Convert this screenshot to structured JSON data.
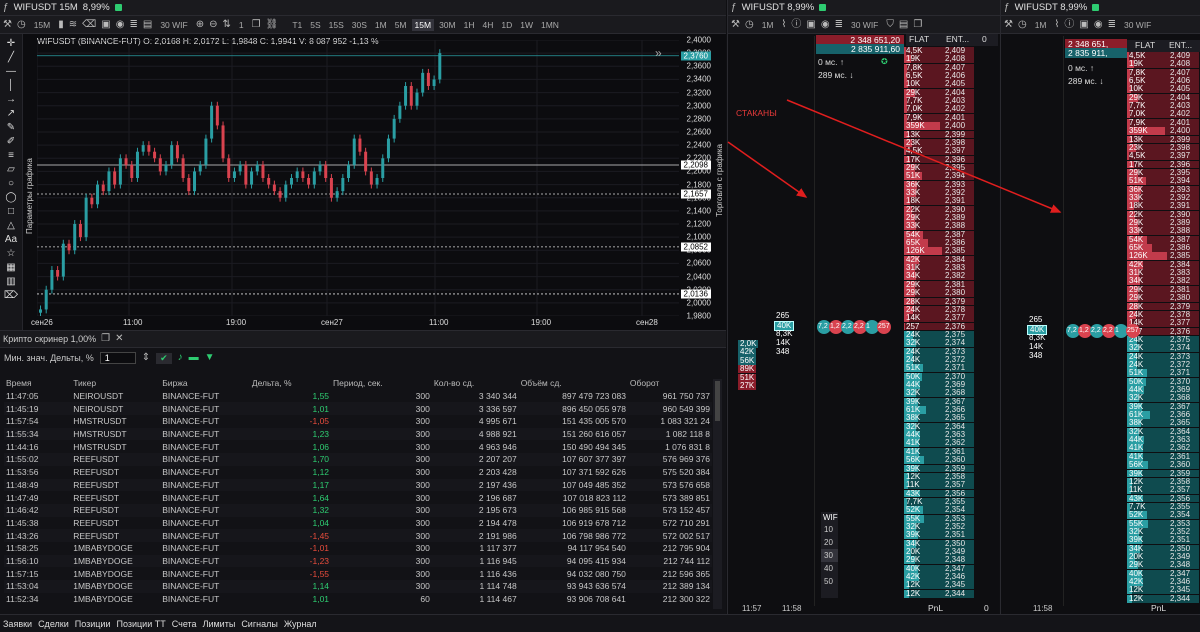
{
  "chart_window": {
    "title": "WIFUSDT 15M",
    "change": "8,99%",
    "interval": "15M",
    "lot": "30 WIF",
    "counter": "1",
    "timeframes": [
      "T1",
      "5S",
      "15S",
      "30S",
      "1M",
      "5M",
      "15M",
      "30M",
      "1H",
      "4H",
      "1D",
      "1W",
      "1MN"
    ],
    "active_tf": "15M",
    "ohlc": "WIFUSDT (BINANCE-FUT) O: 2,0168  H: 2,0172  L: 1,9848  C: 1,9941  V: 8 087 952  -1,13 %",
    "side_label_left": "Параметры графика",
    "side_label_right": "Торговля с графика",
    "price_labels": [
      "2,3760",
      "2,2098",
      "2,1657",
      "2,0852",
      "2,0136"
    ]
  },
  "chart_data": {
    "type": "candlestick",
    "ylim": [
      1.98,
      2.4
    ],
    "y_ticks": [
      "2,4000",
      "2,3800",
      "2,3600",
      "2,3400",
      "2,3200",
      "2,3000",
      "2,2800",
      "2,2600",
      "2,2400",
      "2,2200",
      "2,2000",
      "2,1800",
      "2,1600",
      "2,1400",
      "2,1200",
      "2,1000",
      "2,0800",
      "2,0600",
      "2,0400",
      "2,0200",
      "2,0000",
      "1,9800"
    ],
    "x_ticks": [
      "сен26",
      "11:00",
      "19:00",
      "сен27",
      "11:00",
      "19:00",
      "сен28"
    ],
    "horizontal_levels": [
      2.376,
      2.2098,
      2.1657,
      2.0852,
      2.0136
    ],
    "close_path": [
      1.99,
      2.02,
      2.05,
      2.04,
      2.09,
      2.08,
      2.12,
      2.1,
      2.16,
      2.15,
      2.18,
      2.17,
      2.2,
      2.18,
      2.22,
      2.21,
      2.19,
      2.23,
      2.24,
      2.23,
      2.22,
      2.2,
      2.21,
      2.24,
      2.22,
      2.19,
      2.17,
      2.2,
      2.21,
      2.25,
      2.3,
      2.27,
      2.22,
      2.19,
      2.2,
      2.21,
      2.18,
      2.2,
      2.21,
      2.19,
      2.18,
      2.17,
      2.16,
      2.18,
      2.19,
      2.2,
      2.19,
      2.18,
      2.2,
      2.21,
      2.19,
      2.16,
      2.17,
      2.19,
      2.21,
      2.25,
      2.23,
      2.2,
      2.18,
      2.19,
      2.22,
      2.25,
      2.28,
      2.3,
      2.33,
      2.3,
      2.32,
      2.35,
      2.33,
      2.34,
      2.38
    ]
  },
  "screener": {
    "title": "Крипто скринер 1,00%",
    "min_delta_label": "Мин. знач. Дельты, %",
    "min_delta_value": "1",
    "columns": [
      "Время",
      "Тикер",
      "Биржа",
      "Дельта, %",
      "Период, сек.",
      "Кол-во сд.",
      "Объём сд.",
      "Оборот"
    ],
    "rows": [
      [
        "11:47:05",
        "NEIROUSDT",
        "BINANCE-FUT",
        "1,55",
        "300",
        "3 340 344",
        "897 479 723 083",
        "961 750 737"
      ],
      [
        "11:45:19",
        "NEIROUSDT",
        "BINANCE-FUT",
        "1,01",
        "300",
        "3 336 597",
        "896 450 055 978",
        "960 549 399"
      ],
      [
        "11:57:54",
        "HMSTRUSDT",
        "BINANCE-FUT",
        "-1,05",
        "300",
        "4 995 671",
        "151 435 005 570",
        "1 083 321 24"
      ],
      [
        "11:55:34",
        "HMSTRUSDT",
        "BINANCE-FUT",
        "1,23",
        "300",
        "4 988 921",
        "151 260 616 057",
        "1 082 118 8"
      ],
      [
        "11:44:16",
        "HMSTRUSDT",
        "BINANCE-FUT",
        "1,06",
        "300",
        "4 963 946",
        "150 490 494 345",
        "1 076 831 8"
      ],
      [
        "11:55:02",
        "REEFUSDT",
        "BINANCE-FUT",
        "1,70",
        "300",
        "2 207 207",
        "107 607 377 397",
        "576 969 376"
      ],
      [
        "11:53:56",
        "REEFUSDT",
        "BINANCE-FUT",
        "1,12",
        "300",
        "2 203 428",
        "107 371 592 626",
        "575 520 384"
      ],
      [
        "11:48:49",
        "REEFUSDT",
        "BINANCE-FUT",
        "1,17",
        "300",
        "2 197 436",
        "107 049 485 352",
        "573 576 658"
      ],
      [
        "11:47:49",
        "REEFUSDT",
        "BINANCE-FUT",
        "1,64",
        "300",
        "2 196 687",
        "107 018 823 112",
        "573 389 851"
      ],
      [
        "11:46:42",
        "REEFUSDT",
        "BINANCE-FUT",
        "1,32",
        "300",
        "2 195 673",
        "106 985 915 568",
        "573 152 457"
      ],
      [
        "11:45:38",
        "REEFUSDT",
        "BINANCE-FUT",
        "1,04",
        "300",
        "2 194 478",
        "106 919 678 712",
        "572 710 291"
      ],
      [
        "11:43:26",
        "REEFUSDT",
        "BINANCE-FUT",
        "-1,45",
        "300",
        "2 191 986",
        "106 798 986 772",
        "572 002 517"
      ],
      [
        "11:58:25",
        "1MBABYDOGE",
        "BINANCE-FUT",
        "-1,01",
        "300",
        "1 117 377",
        "94 117 954 540",
        "212 795 904"
      ],
      [
        "11:56:10",
        "1MBABYDOGE",
        "BINANCE-FUT",
        "-1,23",
        "300",
        "1 116 945",
        "94 095 415 934",
        "212 744 112"
      ],
      [
        "11:57:15",
        "1MBABYDOGE",
        "BINANCE-FUT",
        "-1,55",
        "300",
        "1 116 436",
        "94 032 080 750",
        "212 596 365"
      ],
      [
        "11:53:04",
        "1MBABYDOGE",
        "BINANCE-FUT",
        "1,14",
        "300",
        "1 114 748",
        "93 943 636 574",
        "212 389 134"
      ],
      [
        "11:52:34",
        "1MBABYDOGE",
        "BINANCE-FUT",
        "1,01",
        "60",
        "1 114 467",
        "93 906 708 641",
        "212 300 322"
      ]
    ]
  },
  "bottom_tabs": [
    "Заявки",
    "Сделки",
    "Позиции",
    "Позиции ТТ",
    "Счета",
    "Лимиты",
    "Сигналы",
    "Журнал"
  ],
  "dom1": {
    "title": "WIFUSDT 8,99%",
    "interval": "1M",
    "lot": "30 WIF",
    "best_ask": "2 348 651,20",
    "best_bid": "2 835 911,60",
    "ping1": "0 мс. ↑",
    "ping2": "289 мс. ↓",
    "head": [
      "FLAT",
      "ENT...",
      "0"
    ],
    "annotation": "СТАКАНЫ",
    "time1": "11:57",
    "time2": "11:58",
    "pnl": "PnL",
    "pnl_val": "0",
    "wif_label": "WIF",
    "lot_options": [
      "10",
      "20",
      "30",
      "40",
      "50"
    ]
  },
  "dom2": {
    "title": "WIFUSDT 8,99%",
    "interval": "1M",
    "lot": "30 WIF",
    "best_ask": "2 348 651,",
    "best_bid": "2 835 911,",
    "ping1": "0 мс. ↑",
    "ping2": "289 мс. ↓",
    "head": [
      "FLAT",
      "ENT..."
    ],
    "time1": "11:58",
    "pnl": "PnL"
  },
  "ladder": {
    "prices": [
      "2,409",
      "2,408",
      "2,407",
      "2,406",
      "2,405",
      "2,404",
      "2,403",
      "2,402",
      "2,401",
      "2,400",
      "2,399",
      "2,398",
      "2,397",
      "2,396",
      "2,395",
      "2,394",
      "2,393",
      "2,392",
      "2,391",
      "2,390",
      "2,389",
      "2,388",
      "2,387",
      "2,386",
      "2,385",
      "2,384",
      "2,383",
      "2,382",
      "2,381",
      "2,380",
      "2,379",
      "2,378",
      "2,377",
      "2,376",
      "2,375",
      "2,374",
      "2,373",
      "2,372",
      "2,371",
      "2,370",
      "2,369",
      "2,368",
      "2,367",
      "2,366",
      "2,365",
      "2,364",
      "2,363",
      "2,362",
      "2,361",
      "2,360",
      "2,359",
      "2,358",
      "2,357",
      "2,356",
      "2,355",
      "2,354",
      "2,353",
      "2,352",
      "2,351",
      "2,350",
      "2,349",
      "2,348",
      "2,347",
      "2,346",
      "2,345",
      "2,344"
    ],
    "volumes": [
      "4,5K",
      "19K",
      "7,8K",
      "6,5K",
      "10K",
      "29K",
      "7,7K",
      "7,0K",
      "7,9K",
      "359K",
      "13K",
      "23K",
      "4,5K",
      "17K",
      "29K",
      "51K",
      "36K",
      "33K",
      "18K",
      "22K",
      "29K",
      "33K",
      "54K",
      "65K",
      "126K",
      "42K",
      "31K",
      "34K",
      "29K",
      "29K",
      "28K",
      "24K",
      "14K",
      "257",
      "24K",
      "32K",
      "24K",
      "24K",
      "51K",
      "50K",
      "44K",
      "32K",
      "39K",
      "61K",
      "38K",
      "32K",
      "44K",
      "41K",
      "41K",
      "56K",
      "39K",
      "12K",
      "11K",
      "43K",
      "7,7K",
      "52K",
      "55K",
      "32K",
      "39K",
      "34K",
      "20K",
      "29K",
      "40K",
      "42K",
      "12K",
      "12K"
    ],
    "fill": [
      5,
      18,
      8,
      7,
      10,
      28,
      8,
      7,
      8,
      95,
      13,
      22,
      5,
      17,
      28,
      48,
      34,
      31,
      17,
      21,
      28,
      31,
      51,
      62,
      100,
      40,
      29,
      32,
      28,
      28,
      27,
      23,
      13,
      2,
      24,
      31,
      24,
      24,
      49,
      48,
      42,
      31,
      37,
      58,
      36,
      31,
      42,
      39,
      39,
      53,
      37,
      12,
      11,
      41,
      8,
      50,
      52,
      31,
      37,
      32,
      19,
      28,
      38,
      40,
      12,
      12
    ],
    "ask_count": 34,
    "trade_boxes": [
      "265",
      "40K",
      "8,3K",
      "14K",
      "348"
    ],
    "left_vols": [
      "2,0K",
      "42K",
      "56K",
      "89K",
      "51K",
      "27K"
    ],
    "tape": [
      "7,2",
      "1,2",
      "2,2",
      "2,2",
      "1",
      "257"
    ]
  }
}
